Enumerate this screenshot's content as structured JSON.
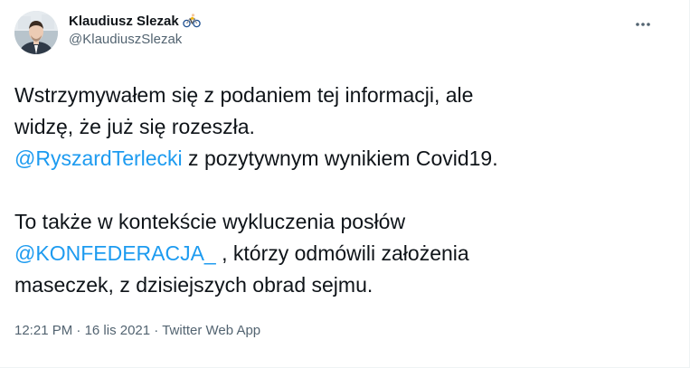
{
  "author": {
    "display_name": "Klaudiusz Slezak",
    "handle": "@KlaudiuszSlezak",
    "badge_icon": "bicycle-emoji-icon"
  },
  "menu": {
    "icon": "more-horizontal-icon"
  },
  "tweet": {
    "line1": "Wstrzymywałem się z podaniem tej informacji, ale",
    "line2": "widzę, że już się rozeszła.",
    "mention1": "@RyszardTerlecki",
    "line3_rest": " z pozytywnym wynikiem Covid19.",
    "line4": "To także w kontekście wykluczenia posłów",
    "mention2": "@KONFEDERACJA_",
    "line5_rest": " , którzy odmówili założenia",
    "line6": "maseczek, z dzisiejszych obrad sejmu."
  },
  "meta": {
    "time": "12:21 PM",
    "sep1": " · ",
    "date": "16 lis 2021",
    "sep2": " · ",
    "source": "Twitter Web App"
  },
  "colors": {
    "text": "#0f1419",
    "secondary": "#536471",
    "link": "#1d9bf0",
    "border": "#eff3f4"
  }
}
